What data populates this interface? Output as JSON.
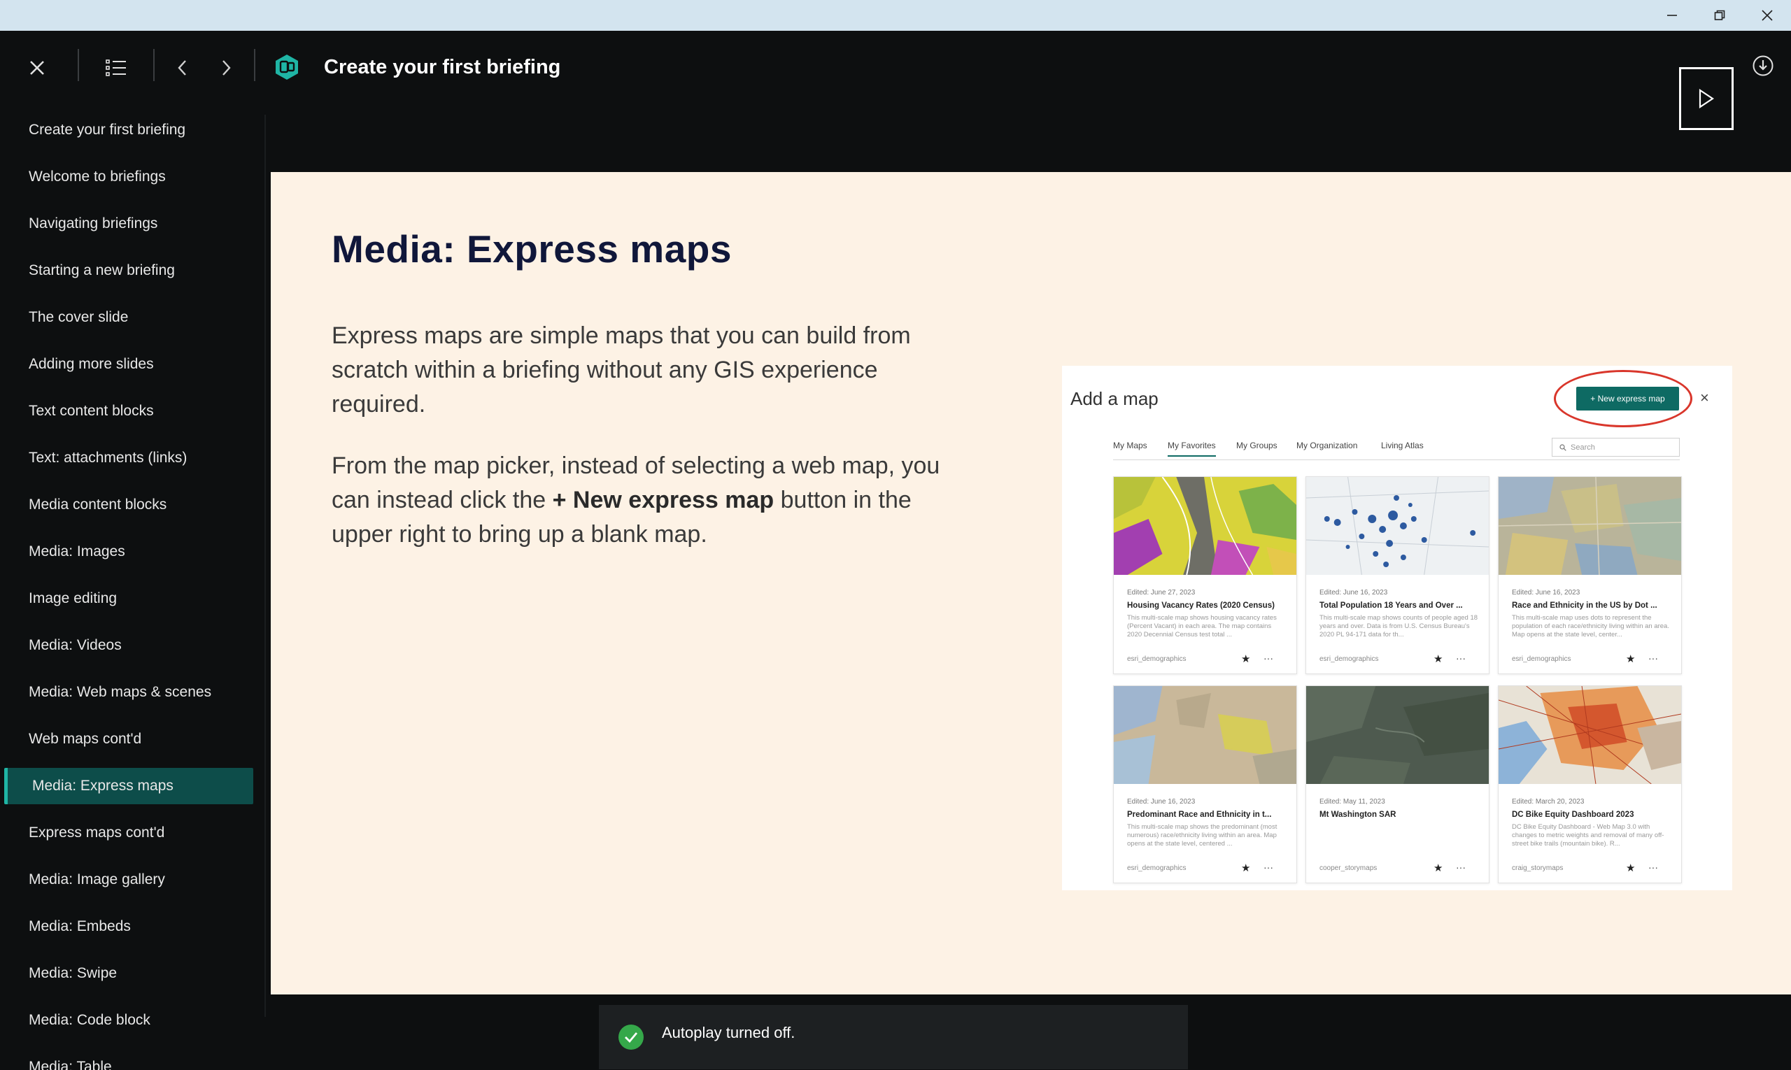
{
  "window": {
    "minimize_icon": "minimize-icon",
    "maximize_icon": "restore-icon",
    "close_icon": "close-icon"
  },
  "header": {
    "title": "Create your first briefing",
    "icons": [
      "close-icon",
      "list-icon",
      "chevron-left-icon",
      "chevron-right-icon",
      "briefing-app-icon",
      "play-icon",
      "download-icon"
    ]
  },
  "sidebar": {
    "items": [
      {
        "label": "Create your first briefing"
      },
      {
        "label": "Welcome to briefings"
      },
      {
        "label": "Navigating briefings"
      },
      {
        "label": "Starting a new briefing"
      },
      {
        "label": "The cover slide"
      },
      {
        "label": "Adding more slides"
      },
      {
        "label": "Text content blocks"
      },
      {
        "label": "Text: attachments (links)"
      },
      {
        "label": "Media content blocks"
      },
      {
        "label": "Media: Images"
      },
      {
        "label": "Image editing"
      },
      {
        "label": "Media: Videos"
      },
      {
        "label": "Media: Web maps & scenes"
      },
      {
        "label": "Web maps cont'd"
      },
      {
        "label": "Media: Express maps",
        "active": true
      },
      {
        "label": "Express maps cont'd"
      },
      {
        "label": "Media: Image gallery"
      },
      {
        "label": "Media: Embeds"
      },
      {
        "label": "Media: Swipe"
      },
      {
        "label": "Media: Code block"
      },
      {
        "label": "Media: Table"
      }
    ]
  },
  "slide": {
    "title": "Media: Express maps",
    "para1": "Express maps are simple maps that you can build from scratch within a briefing without any GIS experience required.",
    "para2_before": "From the map picker, instead of selecting a web map, you can instead click the ",
    "para2_bold": "+ New express map",
    "para2_after": " button in the upper right to bring up a blank map."
  },
  "embedded_image": {
    "title": "Add a map",
    "new_button": "+ New express map",
    "close": "×",
    "tabs": [
      "My Maps",
      "My Favorites",
      "My Groups",
      "My Organization",
      "Living Atlas"
    ],
    "selected_tab": "My Favorites",
    "search_placeholder": "Search",
    "cards": [
      {
        "date": "Edited: June 27, 2023",
        "name": "Housing Vacancy Rates (2020 Census)",
        "desc": "This multi-scale map shows housing vacancy rates (Percent Vacant) in each area. The map contains 2020 Decennial Census test total ...",
        "owner": "esri_demographics"
      },
      {
        "date": "Edited: June 16, 2023",
        "name": "Total Population 18 Years and Over ...",
        "desc": "This multi-scale map shows counts of people aged 18 years and over. Data is from U.S. Census Bureau's 2020 PL 94-171 data for th...",
        "owner": "esri_demographics"
      },
      {
        "date": "Edited: June 16, 2023",
        "name": "Race and Ethnicity in the US by Dot ...",
        "desc": "This multi-scale map uses dots to represent the population of each race/ethnicity living within an area. Map opens at the state level, center...",
        "owner": "esri_demographics"
      },
      {
        "date": "Edited: June 16, 2023",
        "name": "Predominant Race and Ethnicity in t...",
        "desc": "This multi-scale map shows the predominant (most numerous) race/ethnicity living within an area. Map opens at the state level, centered ...",
        "owner": "esri_demographics"
      },
      {
        "date": "Edited: May 11, 2023",
        "name": "Mt Washington SAR",
        "desc": "",
        "owner": "cooper_storymaps"
      },
      {
        "date": "Edited: March 20, 2023",
        "name": "DC Bike Equity Dashboard 2023",
        "desc": "DC Bike Equity Dashboard - Web Map 3.0 with changes to metric weights and removal of many off-street bike trails (mountain bike). R...",
        "owner": "craig_storymaps"
      }
    ]
  },
  "toast": {
    "text": "Autoplay turned off.",
    "status_color": "#35a84a"
  },
  "colors": {
    "accent": "#1fb5a5",
    "active_item_bg": "#0d4d4a",
    "slide_bg": "#fdf2e5",
    "title_color": "#10173a"
  }
}
